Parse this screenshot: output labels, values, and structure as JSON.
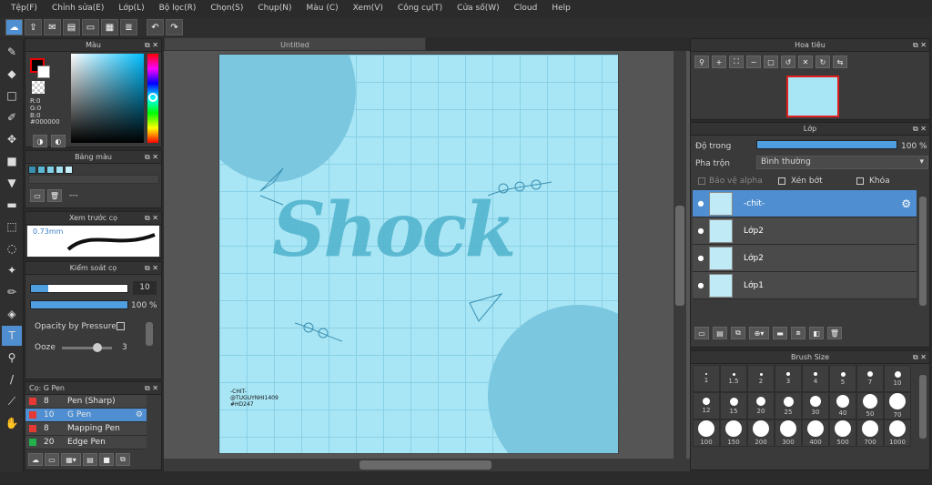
{
  "menu": [
    "Tệp(F)",
    "Chỉnh sửa(E)",
    "Lớp(L)",
    "Bộ lọc(R)",
    "Chọn(S)",
    "Chụp(N)",
    "Màu (C)",
    "Xem(V)",
    "Công cụ(T)",
    "Cửa số(W)",
    "Cloud",
    "Help"
  ],
  "document": {
    "title": "Untitled"
  },
  "color_panel": {
    "title": "Màu",
    "r": "R:0",
    "g": "G:0",
    "b": "B:0",
    "hex": "#000000"
  },
  "palette_panel": {
    "title": "Bảng màu",
    "name": "---",
    "swatches": [
      "#3a8fb0",
      "#5cb7d4",
      "#7fcfe6",
      "#a3e1f2",
      "#c9f0fa"
    ]
  },
  "brush_preview": {
    "title": "Xem trước cọ",
    "size": "0.73mm"
  },
  "brush_control": {
    "title": "Kiểm soát cọ",
    "size_value": "10",
    "opacity_value": "100 %",
    "opacity_fraction": 1.0,
    "pressure_label": "Opacity by Pressure",
    "ooze_label": "Ooze",
    "ooze_value": "3"
  },
  "brush_list": {
    "title": "Cọ: G Pen",
    "items": [
      {
        "num": "8",
        "name": "Pen (Sharp)",
        "color": "#e53935"
      },
      {
        "num": "10",
        "name": "G Pen",
        "color": "#e53935",
        "selected": true
      },
      {
        "num": "8",
        "name": "Mapping Pen",
        "color": "#e53935"
      },
      {
        "num": "20",
        "name": "Edge Pen",
        "color": "#22b14c"
      }
    ]
  },
  "navigator": {
    "title": "Hoa tiêu"
  },
  "layers_panel": {
    "title": "Lớp",
    "opacity_label": "Độ trong",
    "opacity_value": "100 %",
    "opacity_fraction": 1.0,
    "blend_label": "Pha trộn",
    "blend_value": "Bình thường",
    "protect_alpha": "Bảo vệ alpha",
    "clipping": "Xén bớt",
    "lock": "Khóa",
    "layers": [
      "-chit-",
      "Lớp2",
      "Lớp2",
      "Lớp1"
    ]
  },
  "brush_size_panel": {
    "title": "Brush Size",
    "sizes": [
      "1",
      "1.5",
      "2",
      "3",
      "4",
      "5",
      "7",
      "10",
      "12",
      "15",
      "20",
      "25",
      "30",
      "40",
      "50",
      "70",
      "100",
      "150",
      "200",
      "300",
      "400",
      "500",
      "700",
      "1000"
    ]
  },
  "artwork": {
    "title_text": "Shock",
    "signature_line1": "-CHIT-",
    "signature_line2": "@TUGUYNHI1409",
    "signature_line3": "#HD247"
  }
}
